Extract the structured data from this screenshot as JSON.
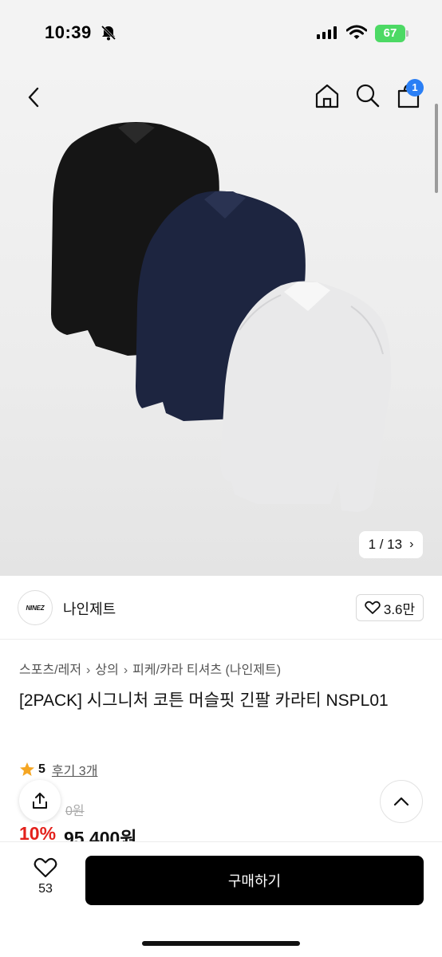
{
  "status_bar": {
    "time": "10:39",
    "battery": "67"
  },
  "nav": {
    "cart_count": "1"
  },
  "gallery": {
    "counter": "1 / 13"
  },
  "brand": {
    "logo_text": "NINEZ",
    "name": "나인제트",
    "likes": "3.6만"
  },
  "breadcrumb": [
    "스포츠/레저",
    "상의",
    "피케/카라 티셔츠 (나인제트)"
  ],
  "product": {
    "title": "[2PACK] 시그니처 코튼 머슬핏 긴팔 카라티 NSPL01",
    "rating": "5",
    "review_link": "후기 3개",
    "original_price": "0원",
    "discount": "10%",
    "price": "95,400원"
  },
  "bottom_bar": {
    "wish_count": "53",
    "buy_label": "구매하기"
  },
  "colors": {
    "accent_blue": "#2a7ff5",
    "discount_red": "#e3211c",
    "battery_green": "#4cd964",
    "buy_button": "#000000"
  },
  "icons": [
    "bell-off-icon",
    "signal-icon",
    "wifi-icon",
    "back-icon",
    "home-icon",
    "search-icon",
    "shopping-bag-icon",
    "chevron-right-icon",
    "heart-icon",
    "star-icon",
    "share-icon",
    "chevron-up-icon"
  ]
}
